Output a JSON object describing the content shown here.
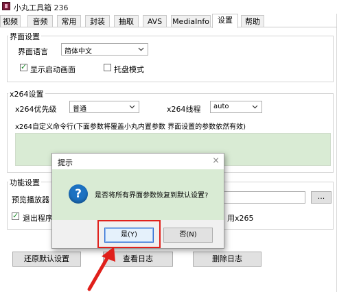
{
  "window": {
    "title": "小丸工具箱 236"
  },
  "tabs": [
    {
      "label": "视频"
    },
    {
      "label": "音频"
    },
    {
      "label": "常用"
    },
    {
      "label": "封装"
    },
    {
      "label": "抽取"
    },
    {
      "label": "AVS"
    },
    {
      "label": "MediaInfo"
    },
    {
      "label": "设置"
    },
    {
      "label": "帮助"
    }
  ],
  "interface_settings": {
    "group_title": "界面设置",
    "language_label": "界面语言",
    "language_value": "简体中文",
    "show_splash_label": "显示启动画面",
    "show_splash_checked": true,
    "tray_mode_label": "托盘模式",
    "tray_mode_checked": false
  },
  "x264_settings": {
    "group_title": "x264设置",
    "priority_label": "x264优先级",
    "priority_value": "普通",
    "threads_label": "x264线程",
    "threads_value": "auto",
    "custom_cmd_label": "x264自定义命令行(下面参数将覆盖小丸内置参数 界面设置的参数依然有效)"
  },
  "function_settings": {
    "group_title": "功能设置",
    "player_label": "预览播放器",
    "browse_label": "...",
    "exit_label": "退出程序",
    "x265_label": "用x265"
  },
  "bottom_buttons": {
    "restore_label": "还原默认设置",
    "view_log_label": "查看日志",
    "delete_log_label": "删除日志"
  },
  "dialog": {
    "title": "提示",
    "close": "×",
    "icon": "?",
    "message": "是否将所有界面参数恢复到默认设置?",
    "yes_label": "是(Y)",
    "no_label": "否(N)"
  },
  "colors": {
    "accent_highlight": "#e0201b",
    "dialog_body": "#d9ebd4",
    "question_icon": "#1d72c2"
  }
}
